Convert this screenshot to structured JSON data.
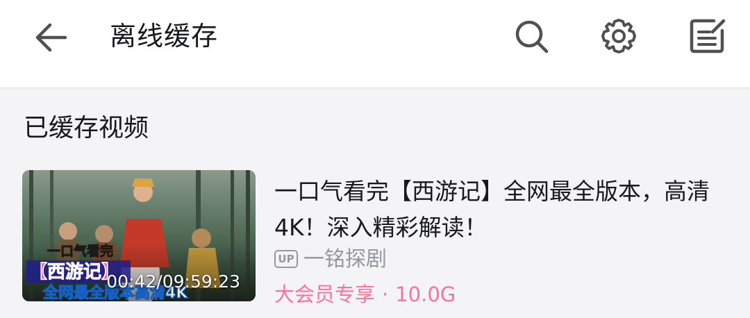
{
  "header": {
    "title": "离线缓存",
    "icons": [
      "back-arrow-icon",
      "search-icon",
      "gear-icon",
      "edit-icon"
    ]
  },
  "section": {
    "title": "已缓存视频"
  },
  "video": {
    "title": "一口气看完【西游记】全网最全版本，高清4K！深入精彩解读！",
    "duration": "00:42/09:59:23",
    "thumbnail_text": {
      "line1": "一口气看完",
      "line2": "【西游记】",
      "line3": "全网最全版本高清4K"
    },
    "up_badge": "UP",
    "uploader": "一铭探剧",
    "vip_label": "大会员专享",
    "separator": "·",
    "size": "10.0G"
  },
  "colors": {
    "accent_pink": "#fb7299",
    "secondary_gray": "#9499a0",
    "background": "#f4f4f6"
  }
}
